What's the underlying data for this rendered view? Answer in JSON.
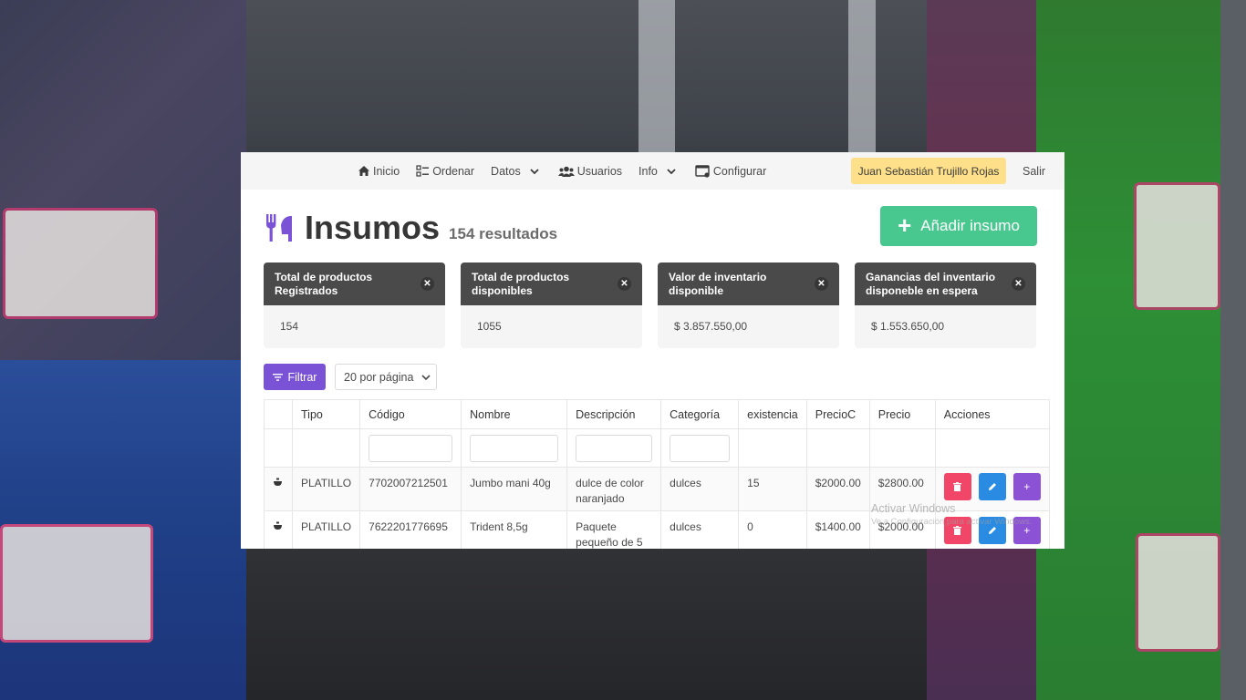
{
  "nav": {
    "items": [
      {
        "label": "Inicio",
        "icon": "home-icon"
      },
      {
        "label": "Ordenar",
        "icon": "checklist-icon"
      },
      {
        "label": "Datos",
        "icon": "chevron-down-icon"
      },
      {
        "label": "Usuarios",
        "icon": "users-icon"
      },
      {
        "label": "Info",
        "icon": "chevron-down-icon"
      },
      {
        "label": "Configurar",
        "icon": "settings-window-icon"
      }
    ],
    "user": "Juan Sebastián Trujillo Rojas",
    "exit": "Salir"
  },
  "page": {
    "title": "Insumos",
    "subtitle": "154 resultados",
    "add_button": "Añadir insumo"
  },
  "cards": [
    {
      "title_1": "Total de productos",
      "title_2": "Registrados",
      "value": "154"
    },
    {
      "title_1": "Total de productos",
      "title_2": "disponibles",
      "value": "1055"
    },
    {
      "title_1": "Valor de inventario",
      "title_2": "disponible",
      "value": "$ 3.857.550,00"
    },
    {
      "title_1": "Ganancias del inventario",
      "title_2": "disponeble en espera",
      "value": "$ 1.553.650,00"
    }
  ],
  "filters": {
    "filter_button": "Filtrar",
    "per_page": "20 por página"
  },
  "table": {
    "headers": [
      "",
      "Tipo",
      "Código",
      "Nombre",
      "Descripción",
      "Categoría",
      "existencia",
      "PrecioC",
      "Precio",
      "Acciones"
    ],
    "rows": [
      {
        "tipo": "PLATILLO",
        "codigo": "7702007212501",
        "nombre": "Jumbo mani 40g",
        "descripcion_1": "dulce de color",
        "descripcion_2": "naranjado",
        "categoria": "dulces",
        "existencia": "15",
        "precioC": "$2000.00",
        "precio": "$2800.00"
      },
      {
        "tipo": "PLATILLO",
        "codigo": "7622201776695",
        "nombre": "Trident 8,5g",
        "descripcion_1": "Paquete",
        "descripcion_2": "pequeño de 5",
        "categoria": "dulces",
        "existencia": "0",
        "precioC": "$1400.00",
        "precio": "$2000.00"
      }
    ]
  },
  "watermark": {
    "title": "Activar Windows",
    "subtitle": "Ve a Configuración para activar Windows."
  },
  "colors": {
    "accent_green": "#48c78e",
    "accent_purple": "#7a52d6",
    "user_badge": "#ffe08a",
    "danger": "#f14668",
    "info": "#2a8be3"
  }
}
